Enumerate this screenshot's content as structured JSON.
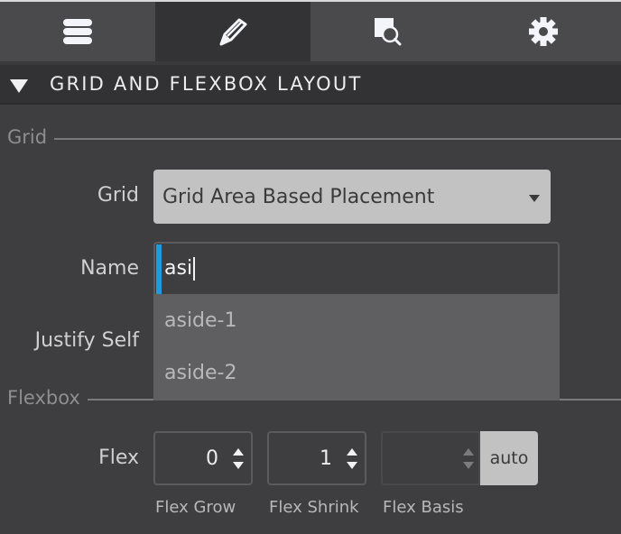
{
  "tabs": [
    {
      "name": "layers",
      "icon": "hamburger-menu-icon",
      "active": false
    },
    {
      "name": "style",
      "icon": "pencil-icon",
      "active": true
    },
    {
      "name": "inspect",
      "icon": "inspect-search-icon",
      "active": false
    },
    {
      "name": "settings",
      "icon": "gear-icon",
      "active": false
    }
  ],
  "section": {
    "title": "GRID AND FLEXBOX LAYOUT",
    "expanded": true
  },
  "grid": {
    "group_label": "Grid",
    "grid_label": "Grid",
    "grid_value": "Grid Area Based Placement",
    "name_label": "Name",
    "name_value": "asi",
    "justify_self_label": "Justify Self",
    "suggestions": [
      "aside-1",
      "aside-2"
    ]
  },
  "flexbox": {
    "group_label": "Flexbox",
    "flex_label": "Flex",
    "flex_grow": {
      "value": "0",
      "label": "Flex Grow"
    },
    "flex_shrink": {
      "value": "1",
      "label": "Flex Shrink"
    },
    "flex_basis": {
      "value": "",
      "label": "Flex Basis",
      "auto_label": "auto"
    }
  },
  "colors": {
    "focus_accent": "#1c9be0",
    "panel_bg": "#3e3e41",
    "header_bg": "#323234"
  }
}
